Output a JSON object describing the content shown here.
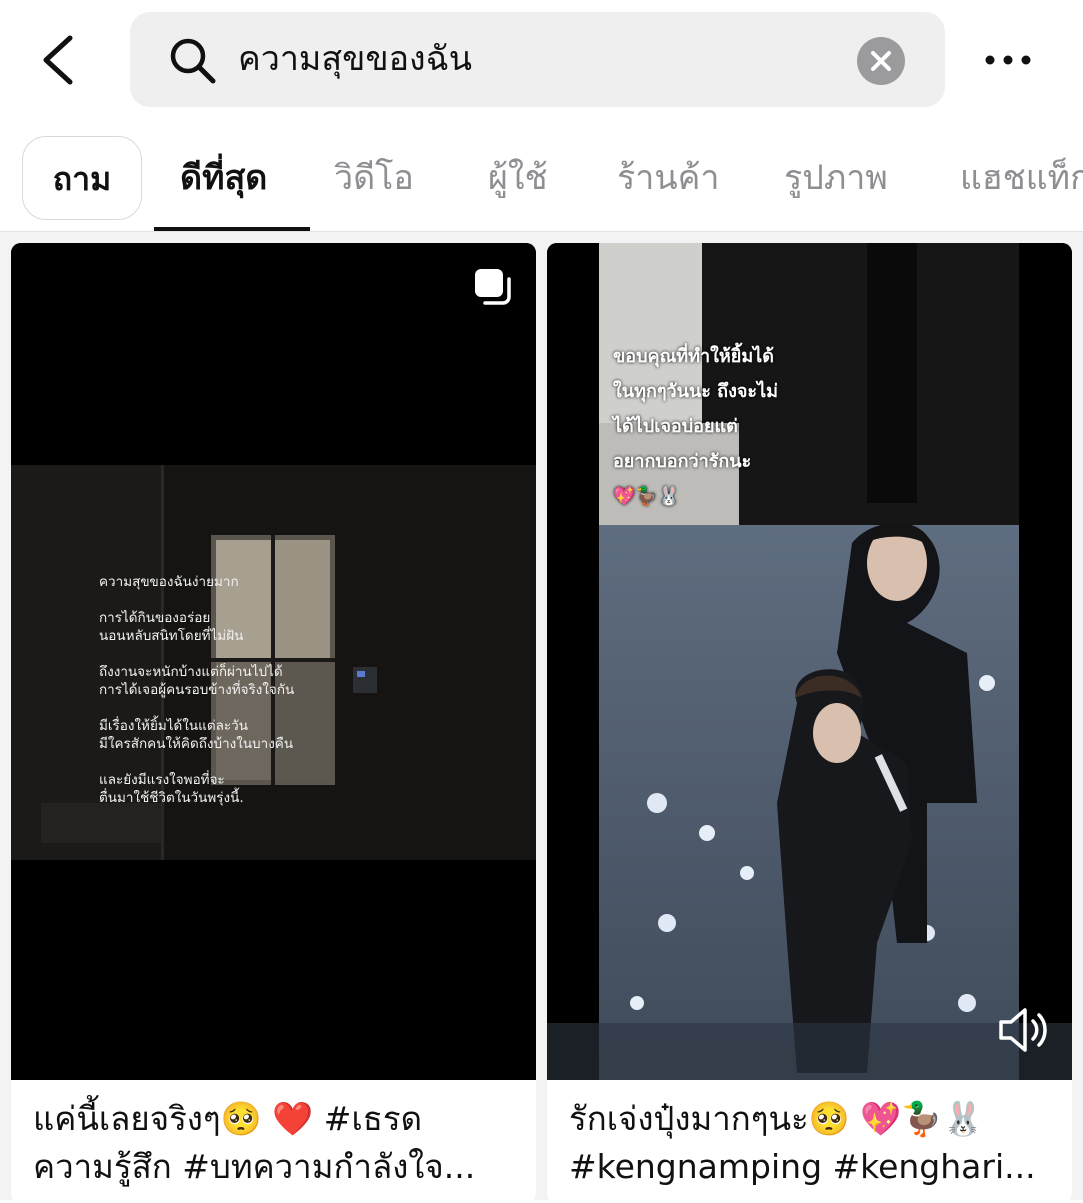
{
  "search": {
    "query": "ความสุขของฉัน",
    "back_icon": "chevron-left-icon",
    "search_icon": "magnifier-icon",
    "clear_icon": "close-circle-icon",
    "more_icon": "ellipsis-icon"
  },
  "tabs": {
    "ask": "ถาม",
    "items": [
      {
        "label": "ดีที่สุด",
        "active": true
      },
      {
        "label": "วิดีโอ",
        "active": false
      },
      {
        "label": "ผู้ใช้",
        "active": false
      },
      {
        "label": "ร้านค้า",
        "active": false
      },
      {
        "label": "รูปภาพ",
        "active": false
      },
      {
        "label": "แฮชแท็ก",
        "active": false
      }
    ]
  },
  "results": [
    {
      "type": "photo-carousel",
      "badge_icon": "multi-photo-icon",
      "poem": [
        [
          "ความสุขของฉันง่ายมาก"
        ],
        [
          "การได้กินของอร่อย",
          "นอนหลับสนิทโดยที่ไม่ฝัน"
        ],
        [
          "ถึงงานจะหนักบ้างแต่ก็ผ่านไปได้",
          "การได้เจอผู้คนรอบข้างที่จริงใจกัน"
        ],
        [
          "มีเรื่องให้ยิ้มได้ในแต่ละวัน",
          "มีใครสักคนให้คิดถึงบ้างในบางคืน"
        ],
        [
          "และยังมีแรงใจพอที่จะ",
          "ตื่นมาใช้ชีวิตในวันพรุ่งนี้."
        ]
      ],
      "caption": [
        "แค่นี้เลยจริงๆ🥺 ❤️ #เธรด",
        "ความรู้สึก #บทความกำลังใจ..."
      ]
    },
    {
      "type": "video",
      "sound_icon": "speaker-icon",
      "overlay": [
        "ขอบคุณที่ทำให้ยิ้มได้",
        "ในทุกๆวันนะ ถึงจะไม่",
        "ได้ไปเจอบ่อยแต่",
        "อยากบอกว่ารักนะ",
        "💖🦆🐰"
      ],
      "caption": [
        "รักเจ่งปุ๋งมากๆนะ🥺 💖🦆🐰",
        "#kengnamping #kenghari..."
      ]
    }
  ]
}
